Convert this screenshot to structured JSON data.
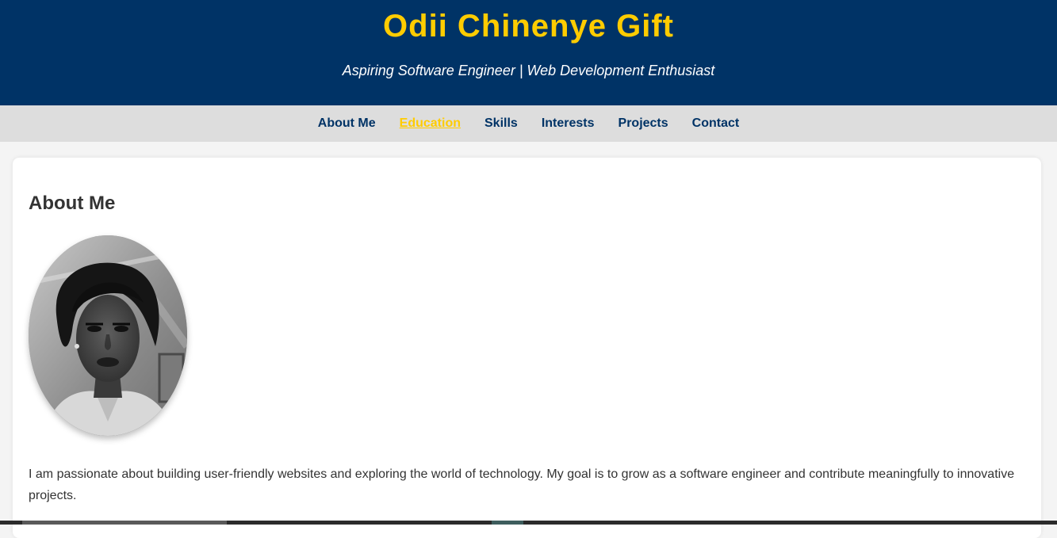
{
  "header": {
    "title": "Odii Chinenye Gift",
    "tagline": "Aspiring Software Engineer | Web Development Enthusiast"
  },
  "nav": {
    "items": [
      {
        "label": "About Me",
        "active": false
      },
      {
        "label": "Education",
        "active": true
      },
      {
        "label": "Skills",
        "active": false
      },
      {
        "label": "Interests",
        "active": false
      },
      {
        "label": "Projects",
        "active": false
      },
      {
        "label": "Contact",
        "active": false
      }
    ]
  },
  "about": {
    "heading": "About Me",
    "photo_icon": "profile-photo",
    "paragraph": "I am passionate about building user-friendly websites and exploring the world of technology. My goal is to grow as a software engineer and contribute meaningfully to innovative projects."
  },
  "colors": {
    "header_bg": "#003366",
    "accent": "#ffcc00",
    "nav_bg": "#dddddd",
    "page_bg": "#f4f4f4",
    "card_bg": "#ffffff",
    "text": "#333333"
  }
}
